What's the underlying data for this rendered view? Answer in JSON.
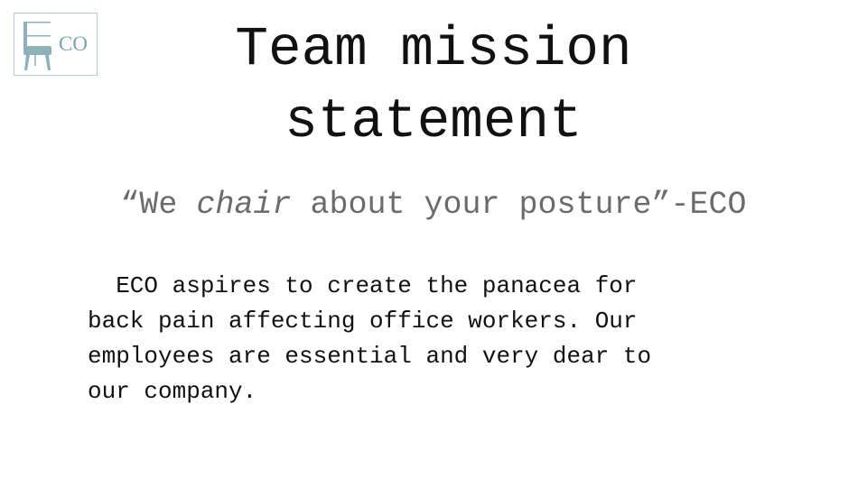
{
  "logo": {
    "text": "CO",
    "icon": "chair-icon",
    "color": "#7aa3ae"
  },
  "slide": {
    "title_line1": "Team mission",
    "title_line2": "statement",
    "quote": {
      "open": "“We ",
      "emph": "chair",
      "rest": " about your posture”-ECO"
    },
    "body_lines": [
      "  ECO aspires to create the panacea for",
      "back pain affecting office workers. Our",
      "employees are essential and very dear to",
      "our company."
    ]
  }
}
